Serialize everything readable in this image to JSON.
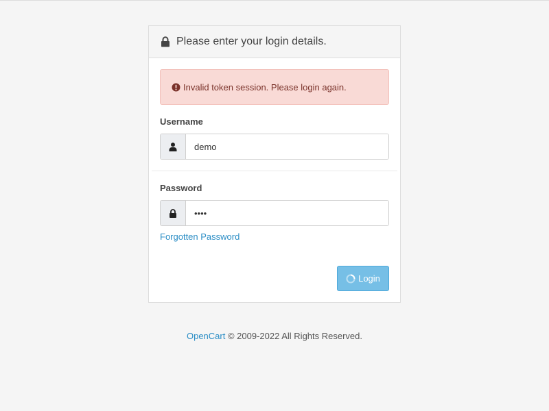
{
  "panel": {
    "heading": "Please enter your login details.",
    "heading_icon": "lock-icon"
  },
  "alert": {
    "icon": "exclamation-circle-icon",
    "text": "Invalid token session. Please login again.",
    "color": "#7a322a",
    "background": "#f9dad6"
  },
  "form": {
    "username": {
      "label": "Username",
      "value": "demo",
      "icon": "user-icon"
    },
    "password": {
      "label": "Password",
      "value": "demo",
      "icon": "lock-icon"
    },
    "forgotten_link": "Forgotten Password",
    "login_button": "Login",
    "login_button_icon": "spinner-icon",
    "login_button_color": "#76bfe6"
  },
  "footer": {
    "brand_link": "OpenCart",
    "text": "© 2009-2022 All Rights Reserved."
  },
  "colors": {
    "link": "#2a8dc5",
    "page_background": "#f5f5f5"
  }
}
